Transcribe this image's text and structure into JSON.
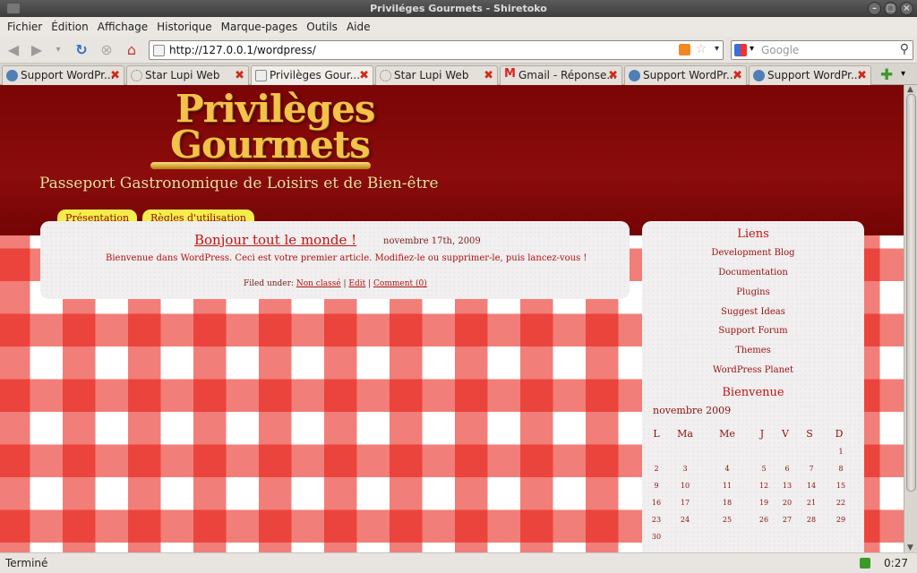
{
  "window": {
    "title": "Priviléges Gourmets - Shiretoko"
  },
  "menu": [
    "Fichier",
    "Édition",
    "Affichage",
    "Historique",
    "Marque-pages",
    "Outils",
    "Aide"
  ],
  "nav": {
    "url": "http://127.0.0.1/wordpress/",
    "search_placeholder": "Google"
  },
  "tabs": [
    {
      "label": "Support WordPr...",
      "icon": "wordpress-icon"
    },
    {
      "label": "Star Lupi Web",
      "icon": "sun-icon"
    },
    {
      "label": "Privilèges Gour...",
      "icon": "page-icon",
      "active": true
    },
    {
      "label": "Star Lupi Web",
      "icon": "sun-icon"
    },
    {
      "label": "Gmail - Réponse...",
      "icon": "gmail-icon"
    },
    {
      "label": "Support WordPr...",
      "icon": "wordpress-icon"
    },
    {
      "label": "Support WordPr...",
      "icon": "wordpress-icon"
    }
  ],
  "site": {
    "logo_line1": "Privilèges",
    "logo_line2": "Gourmets",
    "tagline": "Passeport Gastronomique de Loisirs et de Bien-être",
    "nav": [
      "Présentation",
      "Règles d'utilisation"
    ]
  },
  "post": {
    "title": "Bonjour tout le monde !",
    "date": "novembre 17th, 2009",
    "body": "Bienvenue dans WordPress. Ceci est votre premier article. Modifiez-le ou supprimer-le, puis lancez-vous !",
    "filed": "Filed under:",
    "category": "Non classé",
    "edit": "Edit",
    "comment": "Comment (0)"
  },
  "sidebar": {
    "links_title": "Liens",
    "links": [
      "Development Blog",
      "Documentation",
      "Plugins",
      "Suggest Ideas",
      "Support Forum",
      "Themes",
      "WordPress Planet"
    ],
    "welcome_title": "Bienvenue",
    "calendar": {
      "month": "novembre 2009",
      "days": [
        "L",
        "Ma",
        "Me",
        "J",
        "V",
        "S",
        "D"
      ],
      "weeks": [
        [
          "",
          "",
          "",
          "",
          "",
          "",
          "1"
        ],
        [
          "2",
          "3",
          "4",
          "5",
          "6",
          "7",
          "8"
        ],
        [
          "9",
          "10",
          "11",
          "12",
          "13",
          "14",
          "15"
        ],
        [
          "16",
          "17",
          "18",
          "19",
          "20",
          "21",
          "22"
        ],
        [
          "23",
          "24",
          "25",
          "26",
          "27",
          "28",
          "29"
        ],
        [
          "30",
          "",
          "",
          "",
          "",
          "",
          ""
        ]
      ]
    }
  },
  "status": {
    "text": "Terminé",
    "clock": "0:27"
  },
  "colors": {
    "accent": "#c41212",
    "header_bg": "#7a0505",
    "nav_tab": "#f5ee4a"
  }
}
